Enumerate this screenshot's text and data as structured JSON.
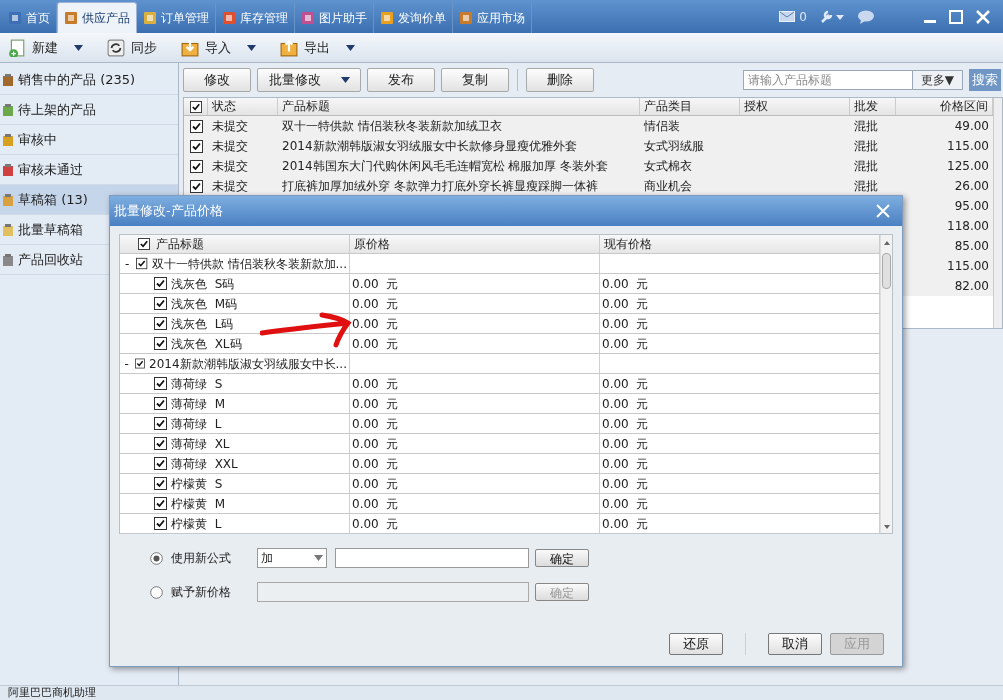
{
  "tabs": [
    {
      "label": "首页",
      "selected": false
    },
    {
      "label": "供应产品",
      "selected": true
    },
    {
      "label": "订单管理",
      "selected": false
    },
    {
      "label": "库存管理",
      "selected": false
    },
    {
      "label": "图片助手",
      "selected": false
    },
    {
      "label": "发询价单",
      "selected": false
    },
    {
      "label": "应用市场",
      "selected": false
    }
  ],
  "mail_count": "0",
  "toolbar": [
    {
      "label": "新建",
      "dropdown": true
    },
    {
      "label": "同步",
      "dropdown": false
    },
    {
      "label": "导入",
      "dropdown": true
    },
    {
      "label": "导出",
      "dropdown": true
    }
  ],
  "sidebar": {
    "items": [
      {
        "label": "销售中的产品 (235)",
        "selected": false
      },
      {
        "label": "待上架的产品",
        "selected": false
      },
      {
        "label": "审核中",
        "selected": false
      },
      {
        "label": "审核未通过",
        "selected": false
      },
      {
        "label": "草稿箱 (13)",
        "selected": true
      },
      {
        "label": "批量草稿箱",
        "selected": false
      },
      {
        "label": "产品回收站",
        "selected": false
      }
    ]
  },
  "actions": [
    {
      "label": "修改",
      "dropdown": false
    },
    {
      "label": "批量修改",
      "dropdown": true
    },
    {
      "label": "发布",
      "dropdown": false
    },
    {
      "label": "复制",
      "dropdown": false
    },
    {
      "label": "删除",
      "dropdown": false
    }
  ],
  "search": {
    "placeholder": "请输入产品标题",
    "more": "更多▼",
    "button": "搜索"
  },
  "table": {
    "header_checked": true,
    "columns": [
      "状态",
      "产品标题",
      "产品类目",
      "授权",
      "批发",
      "价格区间"
    ],
    "rows": [
      {
        "checked": true,
        "status": "未提交",
        "title": "双十一特供款 情侣装秋冬装新款加绒卫衣",
        "category": "情侣装",
        "wholesale": "混批",
        "price": "49.00"
      },
      {
        "checked": true,
        "status": "未提交",
        "title": "2014新款潮韩版淑女羽绒服女中长款修身显瘦优雅外套",
        "category": "女式羽绒服",
        "wholesale": "混批",
        "price": "115.00"
      },
      {
        "checked": true,
        "status": "未提交",
        "title": "2014韩国东大门代购休闲风毛毛连帽宽松 棉服加厚 冬装外套",
        "category": "女式棉衣",
        "wholesale": "混批",
        "price": "125.00"
      },
      {
        "checked": true,
        "status": "未提交",
        "title": "打底裤加厚加绒外穿 冬款弹力打底外穿长裤显瘦踩脚一体裤",
        "category": "商业机会",
        "wholesale": "混批",
        "price": "26.00"
      },
      {
        "price": "95.00"
      },
      {
        "price": "118.00"
      },
      {
        "price": "85.00"
      },
      {
        "price": "115.00"
      },
      {
        "price": "82.00"
      }
    ]
  },
  "dialog": {
    "title": "批量修改-产品价格",
    "columns": [
      "产品标题",
      "原价格",
      "现有价格"
    ],
    "header_checked": true,
    "groups": [
      {
        "title": "双十一特供款 情侣装秋冬装新款加...",
        "checked": true,
        "toggle": "-",
        "children": [
          {
            "label": "浅灰色  S码",
            "checked": true,
            "original_price": "0.00  元",
            "current_price": "0.00  元"
          },
          {
            "label": "浅灰色  M码",
            "checked": true,
            "original_price": "0.00  元",
            "current_price": "0.00  元"
          },
          {
            "label": "浅灰色  L码",
            "checked": true,
            "original_price": "0.00  元",
            "current_price": "0.00  元"
          },
          {
            "label": "浅灰色  XL码",
            "checked": true,
            "original_price": "0.00  元",
            "current_price": "0.00  元"
          }
        ]
      },
      {
        "title": "2014新款潮韩版淑女羽绒服女中长...",
        "checked": true,
        "toggle": "-",
        "children": [
          {
            "label": "薄荷绿  S",
            "checked": true,
            "original_price": "0.00  元",
            "current_price": "0.00  元"
          },
          {
            "label": "薄荷绿  M",
            "checked": true,
            "original_price": "0.00  元",
            "current_price": "0.00  元"
          },
          {
            "label": "薄荷绿  L",
            "checked": true,
            "original_price": "0.00  元",
            "current_price": "0.00  元"
          },
          {
            "label": "薄荷绿  XL",
            "checked": true,
            "original_price": "0.00  元",
            "current_price": "0.00  元"
          },
          {
            "label": "薄荷绿  XXL",
            "checked": true,
            "original_price": "0.00  元",
            "current_price": "0.00  元"
          },
          {
            "label": "柠檬黄  S",
            "checked": true,
            "original_price": "0.00  元",
            "current_price": "0.00  元"
          },
          {
            "label": "柠檬黄  M",
            "checked": true,
            "original_price": "0.00  元",
            "current_price": "0.00  元"
          },
          {
            "label": "柠檬黄  L",
            "checked": true,
            "original_price": "0.00  元",
            "current_price": "0.00  元"
          }
        ]
      }
    ],
    "options": [
      {
        "kind": "formula",
        "label": "使用新公式",
        "selected": true,
        "operator": "加",
        "confirm": "确定",
        "disabled": false
      },
      {
        "kind": "assign",
        "label": "赋予新价格",
        "selected": false,
        "confirm": "确定",
        "disabled": true
      }
    ],
    "buttons": [
      {
        "label": "还原",
        "disabled": false
      },
      {
        "label": "取消",
        "disabled": false
      },
      {
        "label": "应用",
        "disabled": true
      }
    ]
  },
  "status_bar": "阿里巴巴商机助理"
}
